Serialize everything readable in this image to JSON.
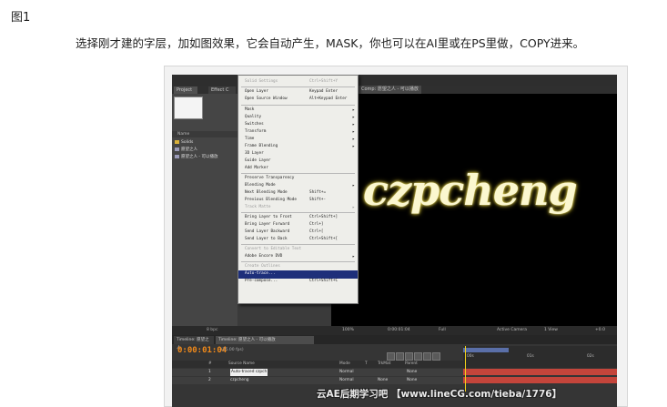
{
  "figure_label": "图1",
  "caption": "选择刚才建的字层，加如图效果，它会自动产生，MASK，你也可以在AI里或在PS里做，COPY进来。",
  "screenshot": {
    "project_panel": {
      "tabs": [
        "Project",
        "Effect C"
      ],
      "column_name": "Name",
      "items": [
        "Solids",
        "愿望之人",
        "愿望之人 - 可以播放"
      ],
      "status": "8 bpc"
    },
    "viewer": {
      "tab": "Comp: 愿望之人 - 可以播放",
      "text": "czpcheng",
      "status": {
        "zoom": "100%",
        "time": "0:00:01:04",
        "resolution": "Full",
        "camera": "Active Camera",
        "views": "1 View",
        "offset": "+0.0"
      }
    },
    "context_menu": {
      "items": [
        {
          "label": "Solid Settings",
          "shortcut": "Ctrl+Shift+Y",
          "disabled": true
        },
        {
          "label": "Open Layer",
          "shortcut": "Keypad Enter"
        },
        {
          "label": "Open Source Window",
          "shortcut": "Alt+Keypad Enter"
        },
        {
          "label": "Mask",
          "submenu": true
        },
        {
          "label": "Quality",
          "submenu": true
        },
        {
          "label": "Switches",
          "submenu": true
        },
        {
          "label": "Transform",
          "submenu": true
        },
        {
          "label": "Time",
          "submenu": true
        },
        {
          "label": "Frame Blending",
          "submenu": true
        },
        {
          "label": "3D Layer"
        },
        {
          "label": "Guide Layer"
        },
        {
          "label": "Add Marker"
        },
        {
          "label": "Preserve Transparency"
        },
        {
          "label": "Blending Mode",
          "submenu": true
        },
        {
          "label": "Next Blending Mode",
          "shortcut": "Shift+="
        },
        {
          "label": "Previous Blending Mode",
          "shortcut": "Shift+-"
        },
        {
          "label": "Track Matte",
          "submenu": true,
          "disabled": true
        },
        {
          "label": "Bring Layer to Front",
          "shortcut": "Ctrl+Shift+]"
        },
        {
          "label": "Bring Layer Forward",
          "shortcut": "Ctrl+]"
        },
        {
          "label": "Send Layer Backward",
          "shortcut": "Ctrl+["
        },
        {
          "label": "Send Layer to Back",
          "shortcut": "Ctrl+Shift+["
        },
        {
          "label": "Convert to Editable Text",
          "disabled": true
        },
        {
          "label": "Adobe Encore DVD",
          "submenu": true
        },
        {
          "label": "Create Outlines",
          "disabled": true
        },
        {
          "label": "Auto-trace...",
          "highlighted": true
        },
        {
          "label": "Pre-compose...",
          "shortcut": "Ctrl+Shift+C"
        }
      ]
    },
    "timeline": {
      "tabs": [
        "Timeline: 愿望之人",
        "Timeline: 愿望之人 - 可以播放"
      ],
      "timecode": "0:00:01:04",
      "fps": "(25.00 fps)",
      "columns": [
        "#",
        "Source Name",
        "Mode",
        "T",
        "TrkMat",
        "Parent"
      ],
      "ruler_marks": [
        "00s",
        "01s",
        "02s"
      ],
      "layers": [
        {
          "num": "1",
          "name": "Auto-traced czpch",
          "mode": "Normal",
          "trkmat": "",
          "parent": "None"
        },
        {
          "num": "2",
          "name": "czpcheng",
          "mode": "Normal",
          "trkmat": "None",
          "parent": "None"
        }
      ]
    }
  },
  "watermark": "云AE后期学习吧 【www.lineCG.com/tieba/1776】"
}
